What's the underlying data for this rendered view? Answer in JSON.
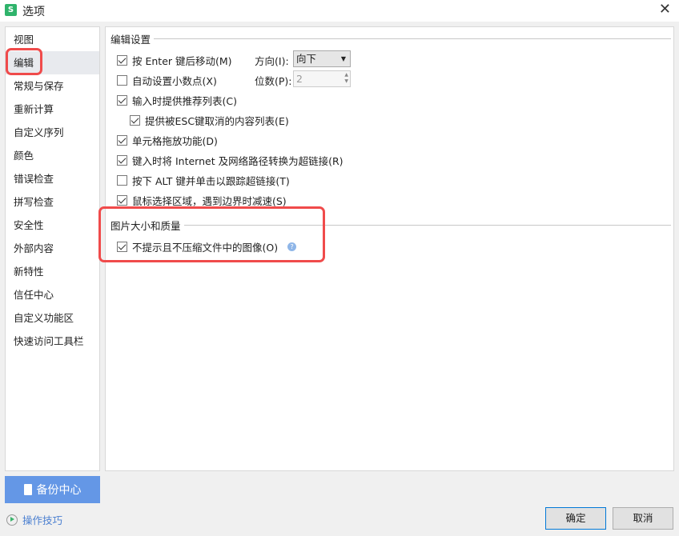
{
  "window": {
    "title": "选项",
    "logo": "S",
    "close": "✕"
  },
  "sidebar": {
    "items": [
      "视图",
      "编辑",
      "常规与保存",
      "重新计算",
      "自定义序列",
      "颜色",
      "错误检查",
      "拼写检查",
      "安全性",
      "外部内容",
      "新特性",
      "信任中心",
      "自定义功能区",
      "快速访问工具栏"
    ],
    "active": "编辑"
  },
  "edit_settings": {
    "title": "编辑设置",
    "options": [
      {
        "label": "按 Enter 键后移动(M)",
        "checked": true
      },
      {
        "label": "自动设置小数点(X)",
        "checked": false
      },
      {
        "label": "输入时提供推荐列表(C)",
        "checked": true
      },
      {
        "label": "提供被ESC键取消的内容列表(E)",
        "checked": true
      },
      {
        "label": "单元格拖放功能(D)",
        "checked": true
      },
      {
        "label": "键入时将 Internet 及网络路径转换为超链接(R)",
        "checked": true
      },
      {
        "label": "按下 ALT 键并单击以跟踪超链接(T)",
        "checked": false
      },
      {
        "label": "鼠标选择区域，遇到边界时减速(S)",
        "checked": true
      }
    ],
    "direction_label": "方向(I):",
    "direction_value": "向下",
    "digits_label": "位数(P):",
    "digits_value": "2"
  },
  "image_settings": {
    "title": "图片大小和质量",
    "option": {
      "label": "不提示且不压缩文件中的图像(O)",
      "checked": true
    },
    "help": "?"
  },
  "footer": {
    "backup": "备份中心",
    "tips": "操作技巧",
    "ok": "确定",
    "cancel": "取消"
  },
  "colors": {
    "accent": "#6497e6",
    "highlight": "#f04b4b"
  }
}
